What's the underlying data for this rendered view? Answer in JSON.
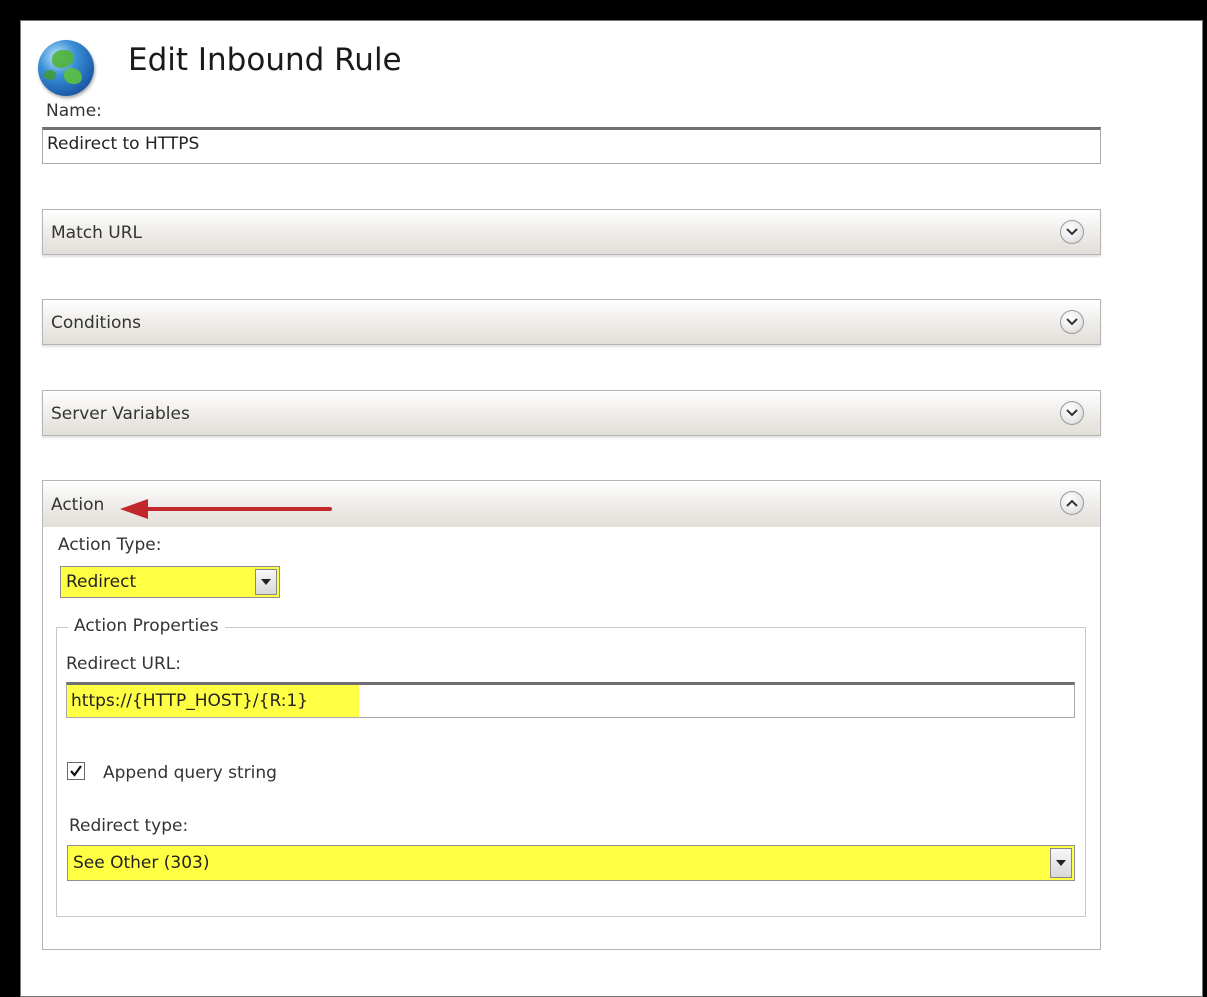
{
  "dialog": {
    "title": "Edit Inbound Rule",
    "globe_icon": "globe-icon"
  },
  "name_field": {
    "label": "Name:",
    "value": "Redirect to HTTPS"
  },
  "sections": {
    "match_url": {
      "label": "Match URL",
      "state": "collapsed",
      "icon": "chevron-down-icon"
    },
    "conditions": {
      "label": "Conditions",
      "state": "collapsed",
      "icon": "chevron-down-icon"
    },
    "server_variables": {
      "label": "Server Variables",
      "state": "collapsed",
      "icon": "chevron-down-icon"
    },
    "action": {
      "label": "Action",
      "state": "expanded",
      "icon": "chevron-up-icon"
    }
  },
  "action": {
    "action_type_label": "Action Type:",
    "action_type_value": "Redirect",
    "properties_legend": "Action Properties",
    "redirect_url_label": "Redirect URL:",
    "redirect_url_value": "https://{HTTP_HOST}/{R:1}",
    "append_query_label": "Append query string",
    "append_query_checked": true,
    "redirect_type_label": "Redirect type:",
    "redirect_type_value": "See Other (303)"
  },
  "annotation": {
    "arrow_color": "#c0282b",
    "highlight_color": "#ffff44"
  }
}
